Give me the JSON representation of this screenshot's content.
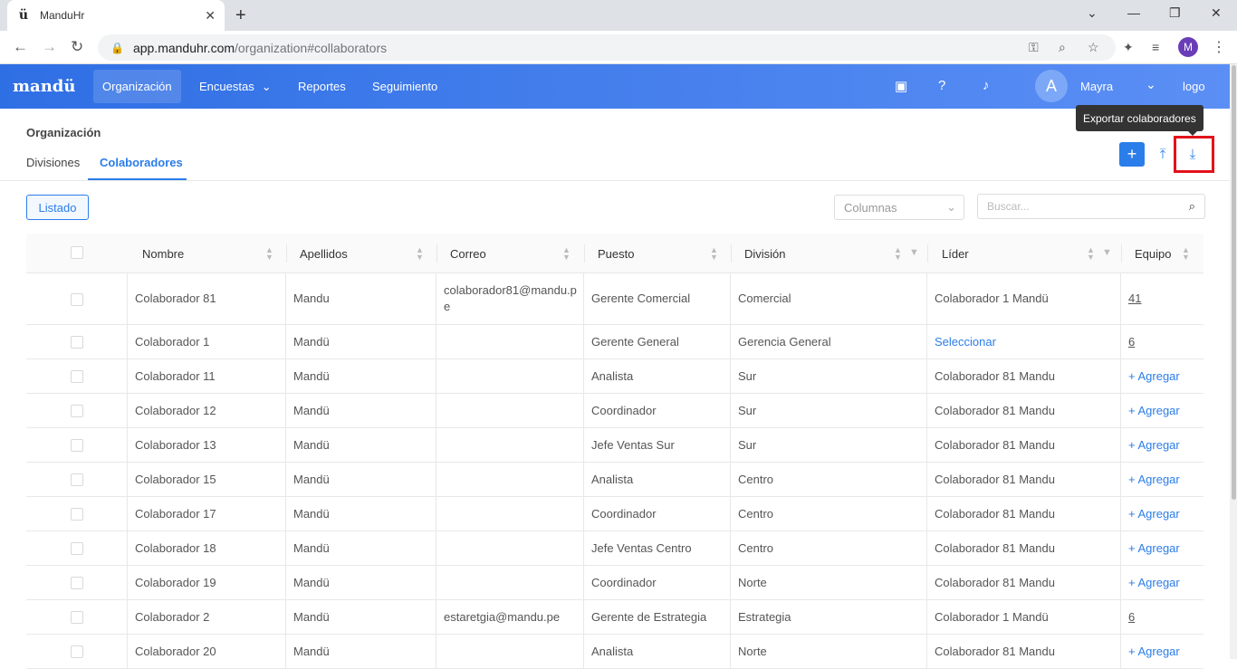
{
  "browser": {
    "tab_title": "ManduHr",
    "favicon": "ü",
    "url_host": "app.manduhr.com",
    "url_path": "/organization#collaborators",
    "profile_initial": "M"
  },
  "header": {
    "logo": "mandü",
    "nav": [
      "Organización",
      "Encuestas",
      "Reportes",
      "Seguimiento"
    ],
    "avatar_initial": "A",
    "username": "Mayra",
    "logo_alt": "logo"
  },
  "page": {
    "title": "Organización",
    "tabs": [
      "Divisiones",
      "Colaboradores"
    ],
    "tooltip": "Exportar colaboradores",
    "listado_label": "Listado",
    "columns_placeholder": "Columnas",
    "search_placeholder": "Buscar..."
  },
  "table": {
    "headers": [
      "Nombre",
      "Apellidos",
      "Correo",
      "Puesto",
      "División",
      "Líder",
      "Equipo"
    ],
    "rows": [
      {
        "nombre": "Colaborador 81",
        "apellidos": "Mandu",
        "correo": "colaborador81@mandu.pe",
        "puesto": "Gerente Comercial",
        "division": "Comercial",
        "lider": "Colaborador 1 Mandü",
        "equipo": "41"
      },
      {
        "nombre": "Colaborador 1",
        "apellidos": "Mandü",
        "correo": "",
        "puesto": "Gerente General",
        "division": "Gerencia General",
        "lider": "Seleccionar",
        "equipo": "6"
      },
      {
        "nombre": "Colaborador 11",
        "apellidos": "Mandü",
        "correo": "",
        "puesto": "Analista",
        "division": "Sur",
        "lider": "Colaborador 81 Mandu",
        "equipo": "+ Agregar"
      },
      {
        "nombre": "Colaborador 12",
        "apellidos": "Mandü",
        "correo": "",
        "puesto": "Coordinador",
        "division": "Sur",
        "lider": "Colaborador 81 Mandu",
        "equipo": "+ Agregar"
      },
      {
        "nombre": "Colaborador 13",
        "apellidos": "Mandü",
        "correo": "",
        "puesto": "Jefe Ventas Sur",
        "division": "Sur",
        "lider": "Colaborador 81 Mandu",
        "equipo": "+ Agregar"
      },
      {
        "nombre": "Colaborador 15",
        "apellidos": "Mandü",
        "correo": "",
        "puesto": "Analista",
        "division": "Centro",
        "lider": "Colaborador 81 Mandu",
        "equipo": "+ Agregar"
      },
      {
        "nombre": "Colaborador 17",
        "apellidos": "Mandü",
        "correo": "",
        "puesto": "Coordinador",
        "division": "Centro",
        "lider": "Colaborador 81 Mandu",
        "equipo": "+ Agregar"
      },
      {
        "nombre": "Colaborador 18",
        "apellidos": "Mandü",
        "correo": "",
        "puesto": "Jefe Ventas Centro",
        "division": "Centro",
        "lider": "Colaborador 81 Mandu",
        "equipo": "+ Agregar"
      },
      {
        "nombre": "Colaborador 19",
        "apellidos": "Mandü",
        "correo": "",
        "puesto": "Coordinador",
        "division": "Norte",
        "lider": "Colaborador 81 Mandu",
        "equipo": "+ Agregar"
      },
      {
        "nombre": "Colaborador 2",
        "apellidos": "Mandü",
        "correo": "estaretgia@mandu.pe",
        "puesto": "Gerente de Estrategia",
        "division": "Estrategia",
        "lider": "Colaborador 1 Mandü",
        "equipo": "6"
      },
      {
        "nombre": "Colaborador 20",
        "apellidos": "Mandü",
        "correo": "",
        "puesto": "Analista",
        "division": "Norte",
        "lider": "Colaborador 81 Mandu",
        "equipo": "+ Agregar"
      }
    ]
  },
  "colors": {
    "accent": "#2b7de9",
    "header_start": "#2f6fe4",
    "highlight": "#e3121b"
  },
  "icons": [
    "back-icon",
    "forward-icon",
    "reload-icon",
    "lock-icon",
    "key-icon",
    "zoom-icon",
    "star-icon",
    "extensions-icon",
    "media-icon",
    "briefcase-icon",
    "help-icon",
    "bell-icon",
    "chevron-down-icon",
    "plus-icon",
    "upload-icon",
    "download-icon",
    "search-icon",
    "sort-icon",
    "filter-icon"
  ]
}
